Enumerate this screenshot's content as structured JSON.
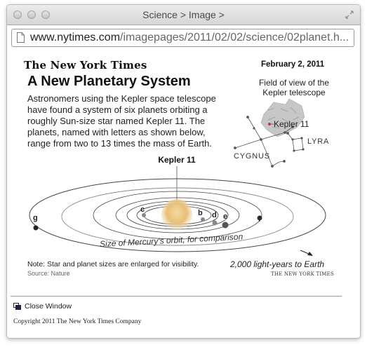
{
  "window": {
    "title": "Science > Image >",
    "url_host": "www.nytimes.com",
    "url_path": "/imagepages/2011/02/02/science/02planet.h..."
  },
  "article": {
    "masthead": "The New York Times",
    "date": "February 2, 2011",
    "headline": "A New Planetary System",
    "body": "Astronomers using the Kepler space telescope have found a system of six planets orbiting a roughly Sun-size star named Kepler 11. The planets, named with letters as shown below, range from two to 13 times the mass of Earth."
  },
  "inset": {
    "title": "Field of view of the Kepler telescope",
    "field_label": "Kepler 11",
    "constellations": [
      "CYGNUS",
      "LYRA"
    ]
  },
  "system": {
    "star_label": "Kepler 11",
    "planets": [
      "b",
      "c",
      "d",
      "e",
      "f",
      "g"
    ],
    "mercury_label": "Size of Mercury's orbit, for comparison"
  },
  "footer": {
    "note": "Note: Star and planet sizes are enlarged for visibility.",
    "source": "Source: Nature",
    "distance": "2,000 light-years to Earth",
    "credit": "THE NEW YORK TIMES",
    "close": "Close Window",
    "copyright": "Copyright 2011 The New York Times Company"
  }
}
